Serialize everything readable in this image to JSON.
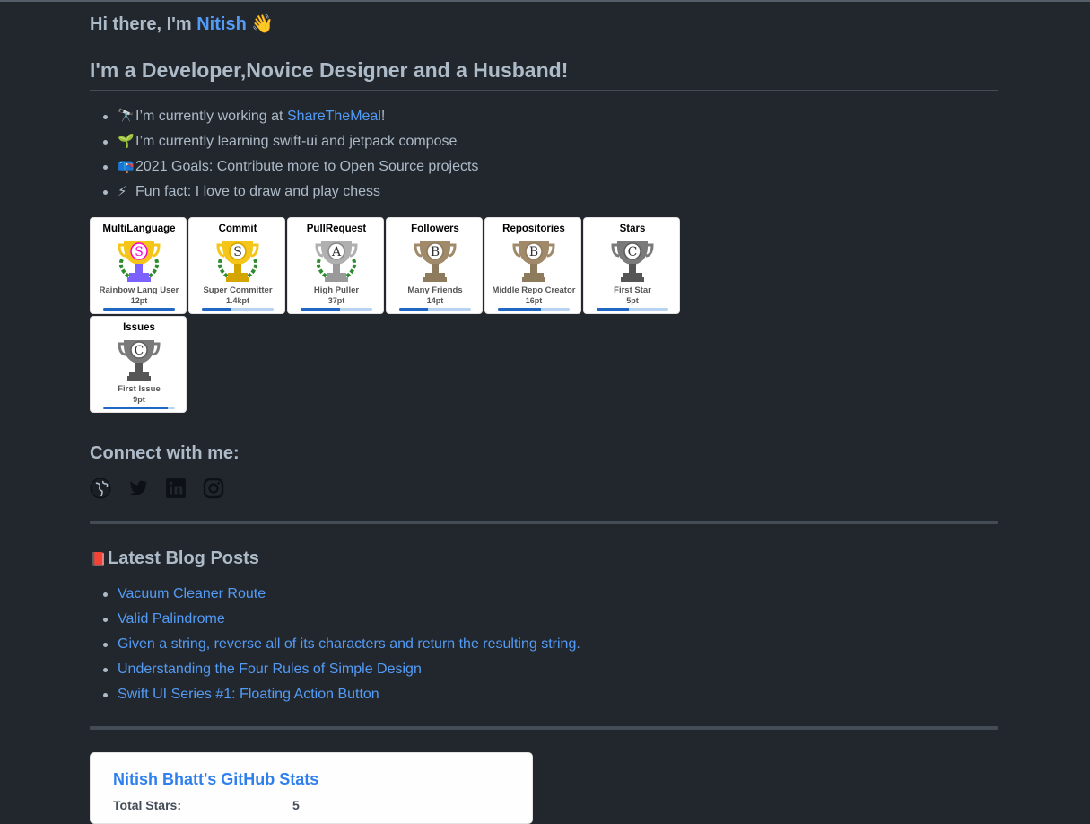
{
  "header": {
    "greeting_prefix": "Hi there, I'm ",
    "name": "Nitish",
    "greeting_emoji": "👋",
    "role": "I'm a Developer,Novice Designer and a Husband!"
  },
  "about": {
    "working": {
      "emoji": "🔭",
      "prefix": "I’m currently working at ",
      "link": "ShareTheMeal",
      "suffix": "!"
    },
    "learning": {
      "emoji": "🌱",
      "text": "I’m currently learning swift-ui and jetpack compose"
    },
    "goals": {
      "emoji": "📪",
      "text": "2021 Goals: Contribute more to Open Source projects"
    },
    "fact": {
      "emoji": "⚡",
      "text": "Fun fact: I love to draw and play chess"
    }
  },
  "trophies": [
    {
      "title": "MultiLanguage",
      "rank": "S",
      "caption": "Rainbow Lang User",
      "points": "12pt",
      "progress": 1.0
    },
    {
      "title": "Commit",
      "rank": "S",
      "caption": "Super Committer",
      "points": "1.4kpt",
      "progress": 0.4
    },
    {
      "title": "PullRequest",
      "rank": "A",
      "caption": "High Puller",
      "points": "37pt",
      "progress": 0.55
    },
    {
      "title": "Followers",
      "rank": "B",
      "caption": "Many Friends",
      "points": "14pt",
      "progress": 0.4
    },
    {
      "title": "Repositories",
      "rank": "B",
      "caption": "Middle Repo Creator",
      "points": "16pt",
      "progress": 0.6
    },
    {
      "title": "Stars",
      "rank": "C",
      "caption": "First Star",
      "points": "5pt",
      "progress": 0.45
    },
    {
      "title": "Issues",
      "rank": "C",
      "caption": "First Issue",
      "points": "9pt",
      "progress": 0.9
    }
  ],
  "connect": {
    "heading": "Connect with me:",
    "icons": [
      "globe-icon",
      "twitter-icon",
      "linkedin-icon",
      "instagram-icon"
    ]
  },
  "blog": {
    "emoji": "📕",
    "heading": "Latest Blog Posts",
    "posts": [
      "Vacuum Cleaner Route",
      "Valid Palindrome",
      "Given a string, reverse all of its characters and return the resulting string.",
      "Understanding the Four Rules of Simple Design",
      "Swift UI Series #1: Floating Action Button"
    ]
  },
  "stats": {
    "title": "Nitish Bhatt's GitHub Stats",
    "first_row_label": "Total Stars:",
    "first_row_value": "5"
  },
  "colors": {
    "background": "#22272e",
    "text": "#adbac7",
    "link": "#539bf5",
    "rule": "#444c56"
  }
}
